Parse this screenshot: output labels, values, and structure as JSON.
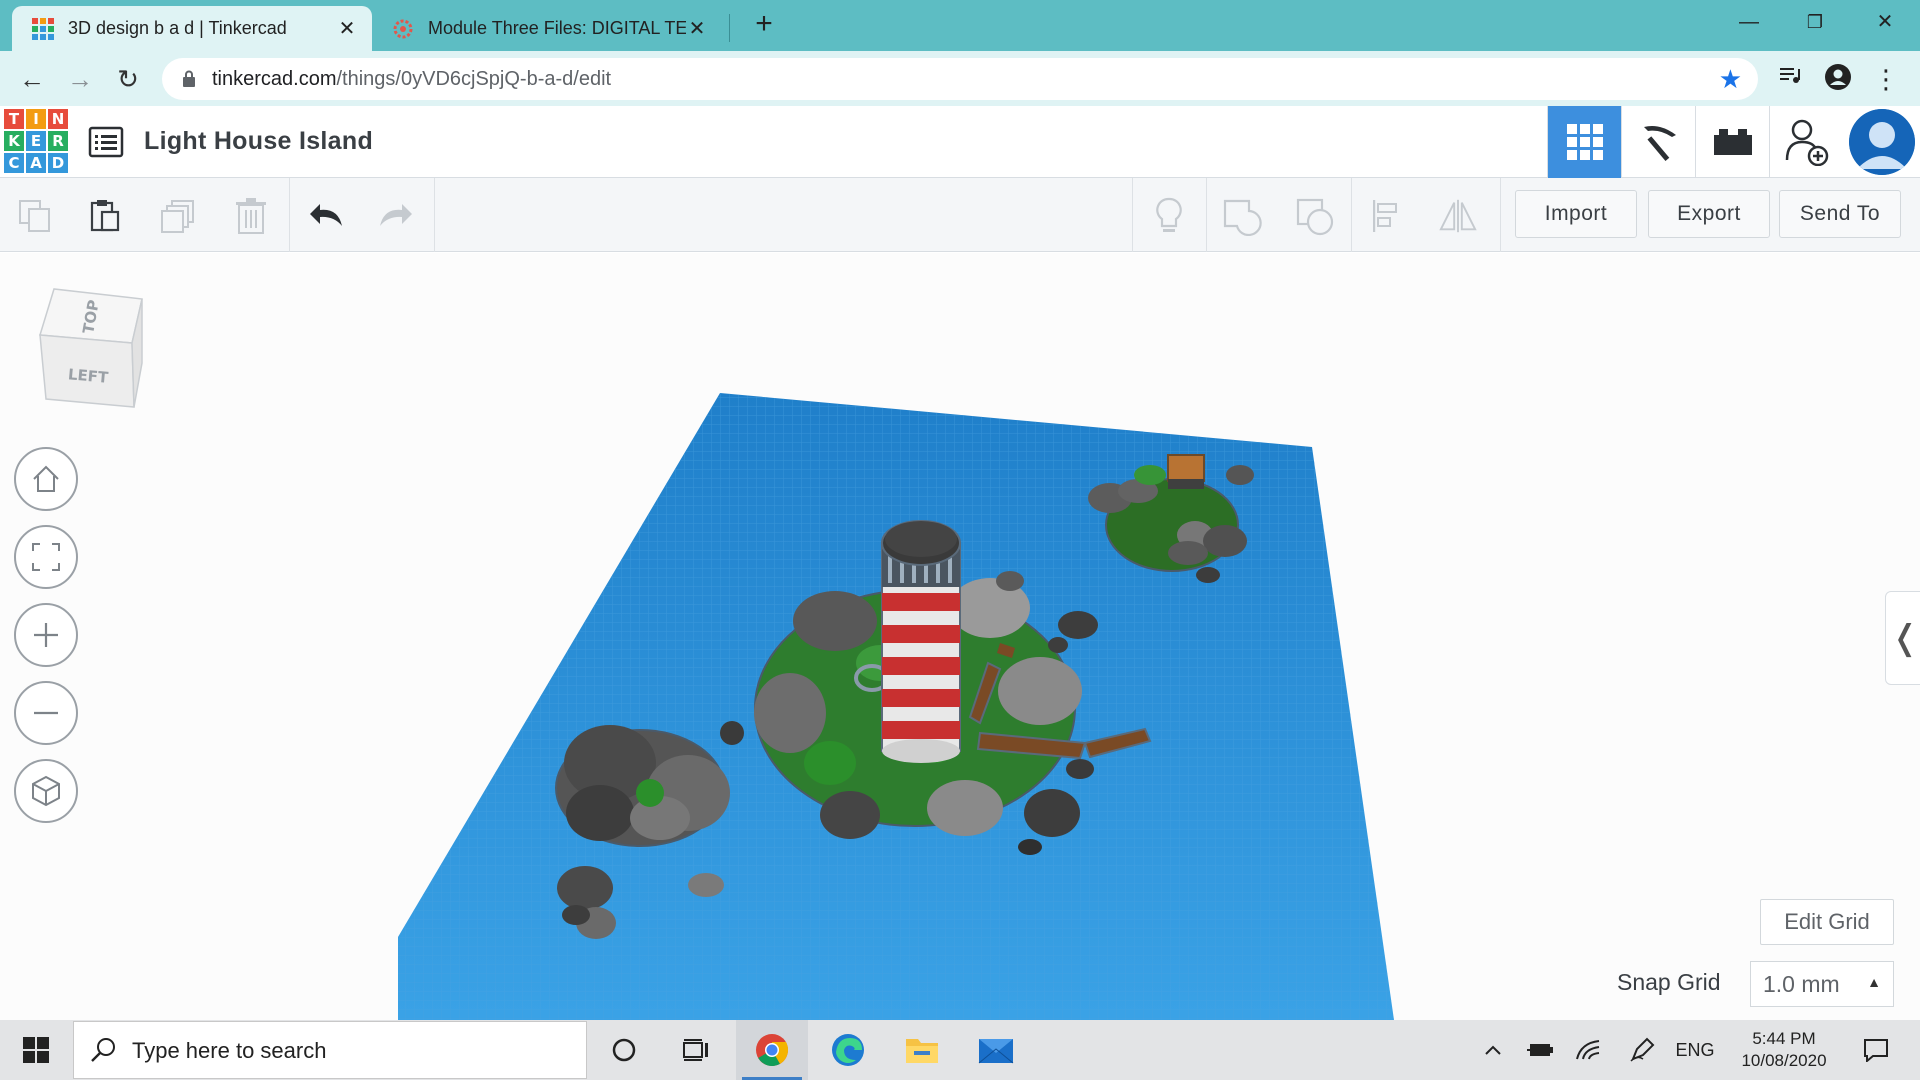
{
  "browser": {
    "tabs": [
      {
        "title": "3D design b a d | Tinkercad",
        "active": true
      },
      {
        "title": "Module Three Files: DIGITAL TECH",
        "active": false
      }
    ],
    "url_host": "tinkercad.com",
    "url_path": "/things/0yVD6cjSpjQ-b-a-d/edit"
  },
  "app": {
    "logo_letters": [
      "T",
      "I",
      "N",
      "K",
      "E",
      "R",
      "C",
      "A",
      "D"
    ],
    "project_title": "Light House Island",
    "header_buttons": [
      "3d-view",
      "blocks",
      "lego-bricks",
      "share",
      "profile"
    ]
  },
  "toolbar": {
    "import_label": "Import",
    "export_label": "Export",
    "send_to_label": "Send To"
  },
  "viewcube": {
    "top_label": "TOP",
    "left_label": "LEFT"
  },
  "workplane": {
    "edit_grid_label": "Edit Grid",
    "snap_grid_label": "Snap Grid",
    "snap_grid_value": "1.0 mm"
  },
  "taskbar": {
    "search_placeholder": "Type here to search",
    "language": "ENG",
    "time": "5:44 PM",
    "date": "10/08/2020"
  },
  "colors": {
    "tab_strip": "#5dbdc3",
    "omnibox_bg": "#dff3f4",
    "tinkercad_blue": "#3d8fde",
    "workplane_blue": "#2a8ad2",
    "island_green": "#2e7d2e",
    "rock_grey": "#6a6a6a"
  }
}
